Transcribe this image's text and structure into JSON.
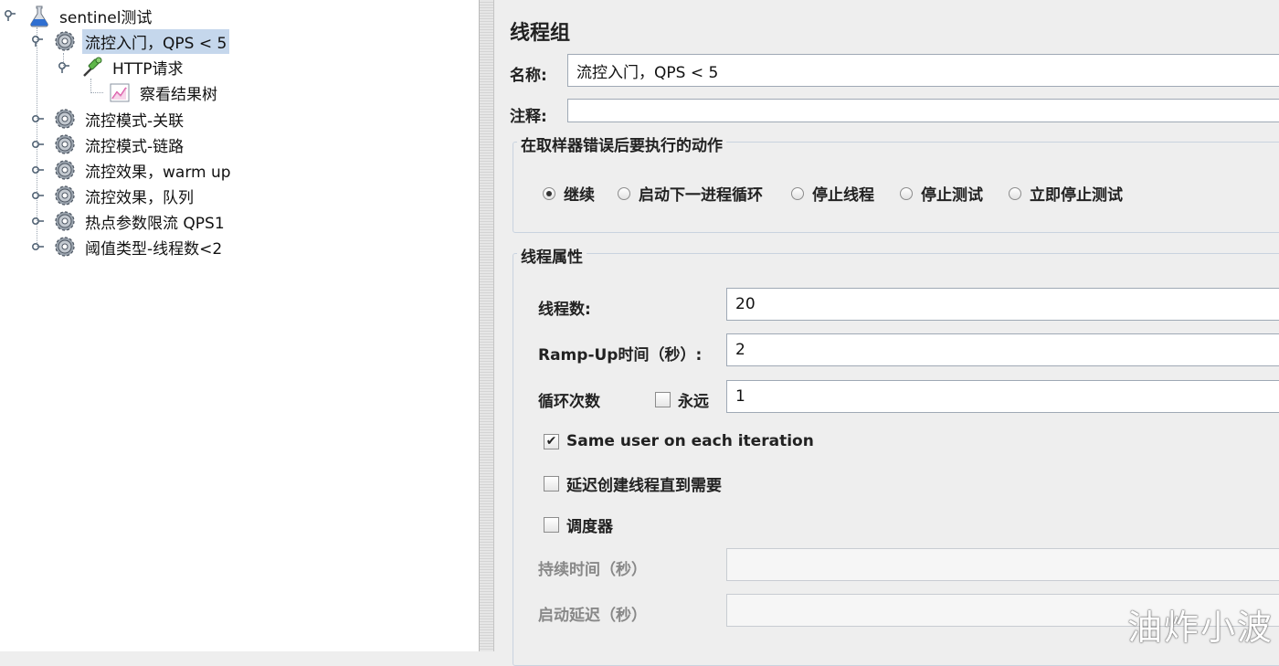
{
  "tree": {
    "root": "sentinel测试",
    "items": [
      {
        "label": "流控入门，QPS < 5",
        "selected": true
      },
      {
        "label": "HTTP请求"
      },
      {
        "label": "察看结果树"
      },
      {
        "label": "流控模式-关联"
      },
      {
        "label": "流控模式-链路"
      },
      {
        "label": "流控效果，warm up"
      },
      {
        "label": "流控效果，队列"
      },
      {
        "label": "热点参数限流 QPS1"
      },
      {
        "label": "阈值类型-线程数<2"
      }
    ]
  },
  "form": {
    "title": "线程组",
    "name_label": "名称:",
    "name_value": "流控入门，QPS < 5",
    "comment_label": "注释:",
    "comment_value": "",
    "error_group": {
      "title": "在取样器错误后要执行的动作",
      "options": [
        "继续",
        "启动下一进程循环",
        "停止线程",
        "停止测试",
        "立即停止测试"
      ],
      "selected": "继续"
    },
    "thread_group": {
      "title": "线程属性",
      "threads_label": "线程数:",
      "threads_value": "20",
      "rampup_label": "Ramp-Up时间（秒）:",
      "rampup_value": "2",
      "loop_label": "循环次数",
      "forever_label": "永远",
      "forever_checked": false,
      "loop_value": "1",
      "same_user_label": "Same user on each iteration",
      "same_user_checked": true,
      "delay_label": "延迟创建线程直到需要",
      "delay_checked": false,
      "scheduler_label": "调度器",
      "scheduler_checked": false,
      "duration_label": "持续时间（秒）",
      "duration_value": "",
      "startup_delay_label": "启动延迟（秒）",
      "startup_delay_value": ""
    }
  },
  "watermark": "油炸小波"
}
